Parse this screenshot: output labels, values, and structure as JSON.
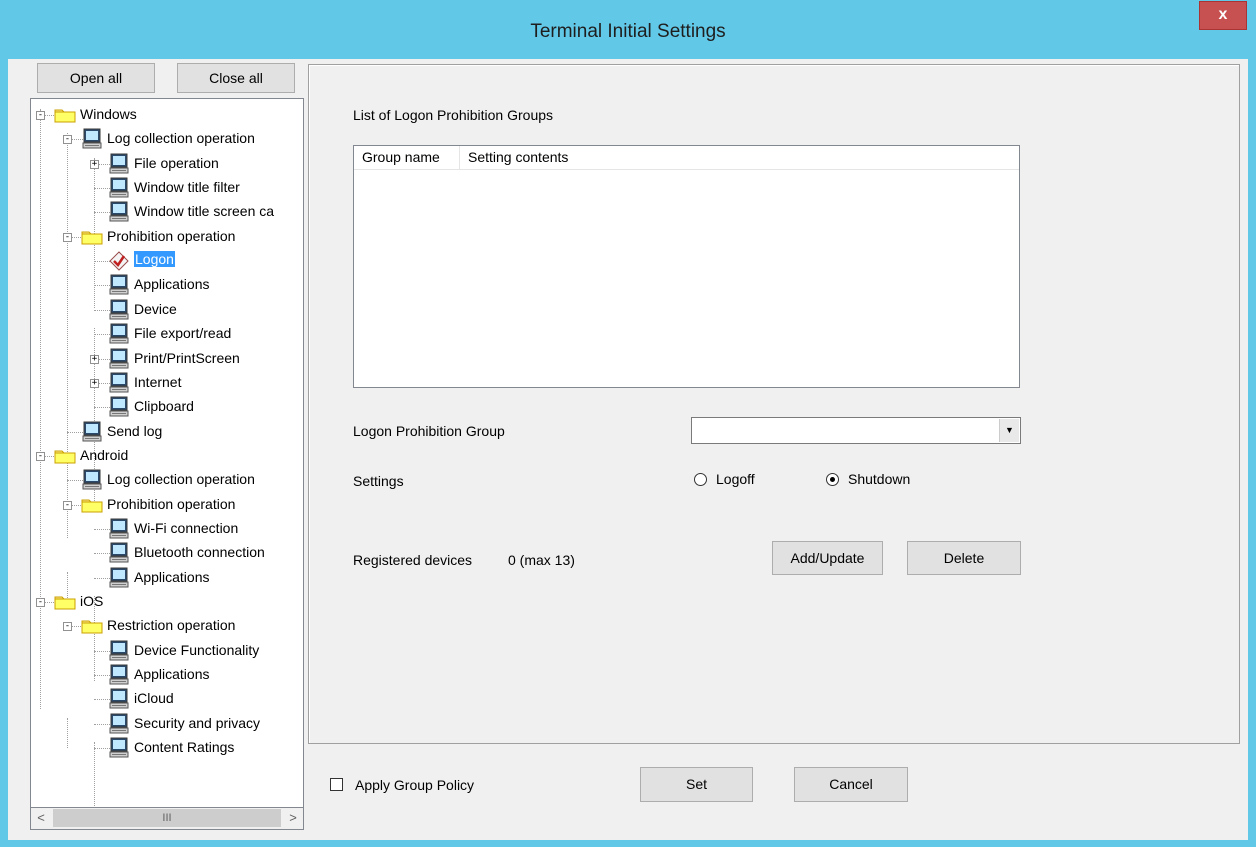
{
  "window": {
    "title": "Terminal Initial Settings",
    "close_label": "x"
  },
  "tree_toolbar": {
    "open_all": "Open all",
    "close_all": "Close all"
  },
  "tree": {
    "items": [
      {
        "label": "Windows",
        "icon": "folder-icon"
      },
      {
        "label": "Log collection operation",
        "icon": "monitor-icon"
      },
      {
        "label": "File operation",
        "icon": "monitor-icon"
      },
      {
        "label": "Window title filter",
        "icon": "monitor-icon"
      },
      {
        "label": "Window title screen ca",
        "icon": "monitor-icon"
      },
      {
        "label": "Prohibition operation",
        "icon": "folder-icon"
      },
      {
        "label": "Logon",
        "icon": "checkmark-diamond-icon",
        "selected": true
      },
      {
        "label": "Applications",
        "icon": "monitor-icon"
      },
      {
        "label": "Device",
        "icon": "monitor-icon"
      },
      {
        "label": "File export/read",
        "icon": "monitor-icon"
      },
      {
        "label": "Print/PrintScreen",
        "icon": "monitor-icon"
      },
      {
        "label": "Internet",
        "icon": "monitor-icon"
      },
      {
        "label": "Clipboard",
        "icon": "monitor-icon"
      },
      {
        "label": "Send log",
        "icon": "monitor-icon"
      },
      {
        "label": "Android",
        "icon": "folder-icon"
      },
      {
        "label": "Log collection operation",
        "icon": "monitor-icon"
      },
      {
        "label": "Prohibition operation",
        "icon": "folder-icon"
      },
      {
        "label": "Wi-Fi connection",
        "icon": "monitor-icon"
      },
      {
        "label": "Bluetooth connection",
        "icon": "monitor-icon"
      },
      {
        "label": "Applications",
        "icon": "monitor-icon"
      },
      {
        "label": "iOS",
        "icon": "folder-icon"
      },
      {
        "label": "Restriction operation",
        "icon": "folder-icon"
      },
      {
        "label": "Device Functionality",
        "icon": "monitor-icon"
      },
      {
        "label": "Applications",
        "icon": "monitor-icon"
      },
      {
        "label": "iCloud",
        "icon": "monitor-icon"
      },
      {
        "label": "Security and privacy",
        "icon": "monitor-icon"
      },
      {
        "label": "Content Ratings",
        "icon": "monitor-icon"
      }
    ]
  },
  "scrollbar": {
    "left": "<",
    "thumb": "III",
    "right": ">"
  },
  "main": {
    "list_title": "List of Logon Prohibition Groups",
    "columns": [
      "Group name",
      "Setting contents"
    ],
    "group_label": "Logon Prohibition Group",
    "group_value": "",
    "settings_label": "Settings",
    "option_logoff": "Logoff",
    "option_shutdown": "Shutdown",
    "selected_option": "Shutdown",
    "registered_label": "Registered devices",
    "registered_value": "0 (max 13)",
    "add_update": "Add/Update",
    "delete": "Delete"
  },
  "footer": {
    "apply_group_policy": "Apply Group Policy",
    "apply_checked": false,
    "set": "Set",
    "cancel": "Cancel"
  },
  "colors": {
    "title_bar": "#62c8e8",
    "close_button": "#c75050",
    "selection": "#3399ff"
  }
}
